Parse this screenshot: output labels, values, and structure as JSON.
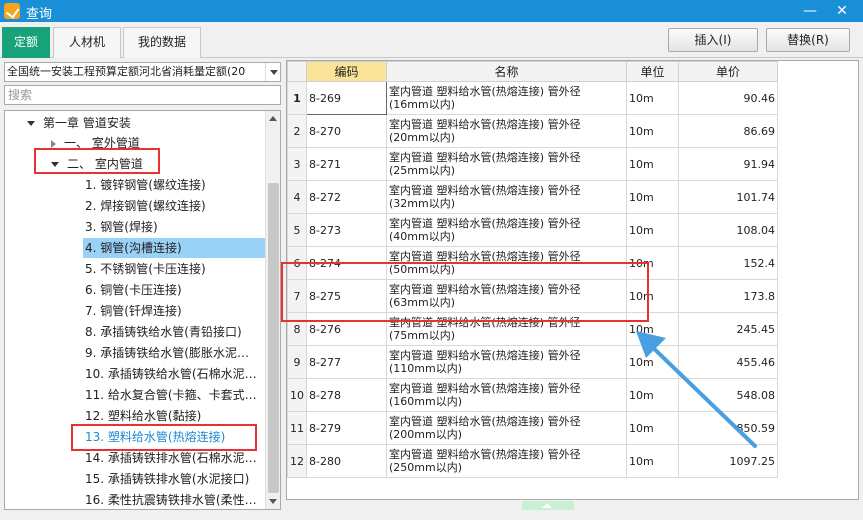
{
  "window": {
    "title": "查询"
  },
  "tabs": [
    "定额",
    "人材机",
    "我的数据"
  ],
  "toolbar": {
    "insert_label": "插入(I)",
    "replace_label": "替换(R)"
  },
  "left": {
    "dataset_value": "全国统一安装工程预算定额河北省消耗量定额(20",
    "search_placeholder": "搜索",
    "tree": [
      "第一章 管道安装",
      "一、 室外管道",
      "二、 室内管道",
      "1. 镀锌钢管(螺纹连接)",
      "2. 焊接钢管(螺纹连接)",
      "3. 钢管(焊接)",
      "4. 钢管(沟槽连接)",
      "5. 不锈钢管(卡压连接)",
      "6. 铜管(卡压连接)",
      "7. 铜管(钎焊连接)",
      "8. 承插铸铁给水管(青铅接口)",
      "9. 承插铸铁给水管(膨胀水泥…",
      "10. 承插铸铁给水管(石棉水泥…",
      "11. 给水复合管(卡箍、卡套式…",
      "12. 塑料给水管(黏接)",
      "13. 塑料给水管(热熔连接)",
      "14. 承插铸铁排水管(石棉水泥…",
      "15. 承插铸铁排水管(水泥接口)",
      "16. 柔性抗震铸铁排水管(柔性…"
    ]
  },
  "table": {
    "headers": [
      "编码",
      "名称",
      "单位",
      "单价"
    ],
    "rows": [
      {
        "no": "1",
        "code": "8-269",
        "name1": "室内管道 塑料给水管(热熔连接) 管外径",
        "name2": "(16mm以内)",
        "unit": "10m",
        "price": "90.46"
      },
      {
        "no": "2",
        "code": "8-270",
        "name1": "室内管道 塑料给水管(热熔连接) 管外径",
        "name2": "(20mm以内)",
        "unit": "10m",
        "price": "86.69"
      },
      {
        "no": "3",
        "code": "8-271",
        "name1": "室内管道 塑料给水管(热熔连接) 管外径",
        "name2": "(25mm以内)",
        "unit": "10m",
        "price": "91.94"
      },
      {
        "no": "4",
        "code": "8-272",
        "name1": "室内管道 塑料给水管(热熔连接) 管外径",
        "name2": "(32mm以内)",
        "unit": "10m",
        "price": "101.74"
      },
      {
        "no": "5",
        "code": "8-273",
        "name1": "室内管道 塑料给水管(热熔连接) 管外径",
        "name2": "(40mm以内)",
        "unit": "10m",
        "price": "108.04"
      },
      {
        "no": "6",
        "code": "8-274",
        "name1": "室内管道 塑料给水管(热熔连接) 管外径",
        "name2": "(50mm以内)",
        "unit": "10m",
        "price": "152.4"
      },
      {
        "no": "7",
        "code": "8-275",
        "name1": "室内管道 塑料给水管(热熔连接) 管外径",
        "name2": "(63mm以内)",
        "unit": "10m",
        "price": "173.8"
      },
      {
        "no": "8",
        "code": "8-276",
        "name1": "室内管道 塑料给水管(热熔连接) 管外径",
        "name2": "(75mm以内)",
        "unit": "10m",
        "price": "245.45"
      },
      {
        "no": "9",
        "code": "8-277",
        "name1": "室内管道 塑料给水管(热熔连接) 管外径",
        "name2": "(110mm以内)",
        "unit": "10m",
        "price": "455.46"
      },
      {
        "no": "10",
        "code": "8-278",
        "name1": "室内管道 塑料给水管(热熔连接) 管外径",
        "name2": "(160mm以内)",
        "unit": "10m",
        "price": "548.08"
      },
      {
        "no": "11",
        "code": "8-279",
        "name1": "室内管道 塑料给水管(热熔连接) 管外径",
        "name2": "(200mm以内)",
        "unit": "10m",
        "price": "850.59"
      },
      {
        "no": "12",
        "code": "8-280",
        "name1": "室内管道 塑料给水管(热熔连接) 管外径",
        "name2": "(250mm以内)",
        "unit": "10m",
        "price": "1097.25"
      }
    ]
  },
  "colors": {
    "titlebar": "#1a8fd8",
    "active_tab": "#17a27a",
    "annotation": "#e8322f",
    "arrow": "#4a9fe0",
    "selection": "#99d1f7"
  }
}
